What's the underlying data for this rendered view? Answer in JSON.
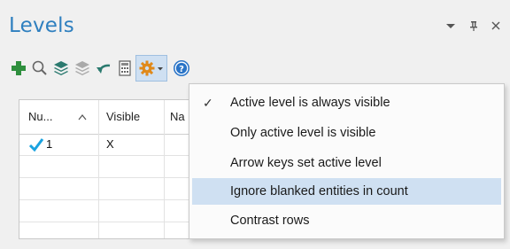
{
  "panel": {
    "title": "Levels",
    "controls": {
      "dropdown": "▾",
      "pin": "ᵖ",
      "close": "×"
    }
  },
  "toolbar": {
    "icons": [
      "add-level-icon",
      "search-icon",
      "layers-icon",
      "layers-gray-icon",
      "undo-arrow-icon",
      "calculator-icon",
      "gear-icon",
      "chevron-down-icon",
      "help-icon"
    ],
    "colors": {
      "add": "#2f8f3e",
      "layers": "#2b7a6f",
      "gear": "#e0891a",
      "help": "#2a74c7"
    }
  },
  "grid": {
    "columns": [
      "Nu...",
      "Visible",
      "Na"
    ],
    "sort_indicator": "^",
    "rows": [
      {
        "number": "1",
        "visible": "X",
        "active": true
      }
    ],
    "empty_rows": 4
  },
  "menu": {
    "items": [
      {
        "label": "Active level is always visible",
        "checked": true,
        "highlighted": false
      },
      {
        "label": "Only active level is visible",
        "checked": false,
        "highlighted": false
      },
      {
        "label": "Arrow keys set active level",
        "checked": false,
        "highlighted": false
      },
      {
        "label": "Ignore blanked entities in count",
        "checked": false,
        "highlighted": true
      },
      {
        "label": "Contrast rows",
        "checked": false,
        "highlighted": false
      }
    ],
    "check_glyph": "✓",
    "highlight_color": "#cfe0f2"
  }
}
